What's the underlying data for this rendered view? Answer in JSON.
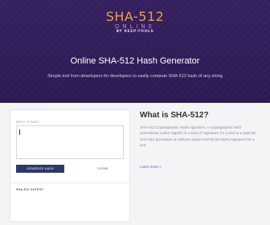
{
  "logo": {
    "line1": "SHA-512",
    "line2": "ONLINE",
    "line3": "BY KEEP-TOOLS"
  },
  "hero": {
    "title": "Online SHA-512 Hash Generator",
    "subtitle": "Simple tool from developers for developers to easily compute SHA-512 hash of any string"
  },
  "form": {
    "input_label": "INPUT STRING",
    "input_value": "",
    "generate_label": "GENERATE HASH",
    "clear_label": "CLEAR",
    "output_label": "SHA-512 OUTPUT:"
  },
  "info": {
    "title": "What is SHA-512?",
    "body": "SHA-512 Cryptographic Hash Algorithm. A cryptographic hash (sometimes called 'digest') is a kind of 'signature' for a text or a data file. SHA-512 generates an almost-unique 512-bit (64-byte) signature for a text.",
    "learn_more": "Learn more »"
  },
  "colors": {
    "hero_bg": "#2f1d58",
    "logo_orange": "#e8a04c",
    "logo_pink": "#c97fd0",
    "button_navy": "#2d3a66",
    "link_blue": "#3a6dc9"
  }
}
